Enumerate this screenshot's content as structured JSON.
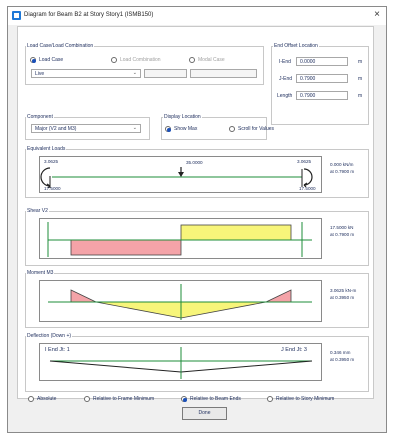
{
  "window": {
    "title": "Diagram for Beam B2 at Story Story1 (ISMB150)"
  },
  "load_case_group": {
    "label": "Load Case/Load Combination",
    "options": [
      "Load Case",
      "Load Combination",
      "Modal Case"
    ],
    "selected_case": "Live"
  },
  "end_offset": {
    "label": "End Offset Location",
    "rows": [
      {
        "label": "I-End",
        "value": "0.0000",
        "unit": "m"
      },
      {
        "label": "J-End",
        "value": "0.7900",
        "unit": "m"
      },
      {
        "label": "Length",
        "value": "0.7900",
        "unit": "m"
      }
    ]
  },
  "component": {
    "label": "Component",
    "value": "Major (V2 and M3)"
  },
  "display_location": {
    "label": "Display Location",
    "options": [
      "Show Max",
      "Scroll for Values"
    ]
  },
  "equivalent_loads": {
    "label": "Equivalent Loads",
    "left_moment": "3.0625",
    "left_force": "17.5000",
    "point_load": "35.0000",
    "right_moment": "3.0625",
    "right_force": "17.5000",
    "value": "0.000 kN/m",
    "location": "at 0.7900 m"
  },
  "shear": {
    "label": "Shear V2",
    "value": "17.5000 kN",
    "location": "at 0.7900 m"
  },
  "moment": {
    "label": "Moment M3",
    "value": "3.0625 kN-m",
    "location": "at 0.3950 m"
  },
  "deflection": {
    "label": "Deflection (Down +)",
    "left_label": "I End Jt: 1",
    "right_label": "J End Jt: 3",
    "value": "0.346 mm",
    "location": "at 0.3950 m"
  },
  "deflection_options": [
    "Absolute",
    "Relative to Frame Minimum",
    "Relative to Beam Ends",
    "Relative to Story Minimum"
  ],
  "done_label": "Done",
  "colors": {
    "positive_fill": "#f4a3a8",
    "negative_fill": "#f7f57a",
    "line": "#1e8c3a",
    "accent": "#1a4fb8"
  }
}
